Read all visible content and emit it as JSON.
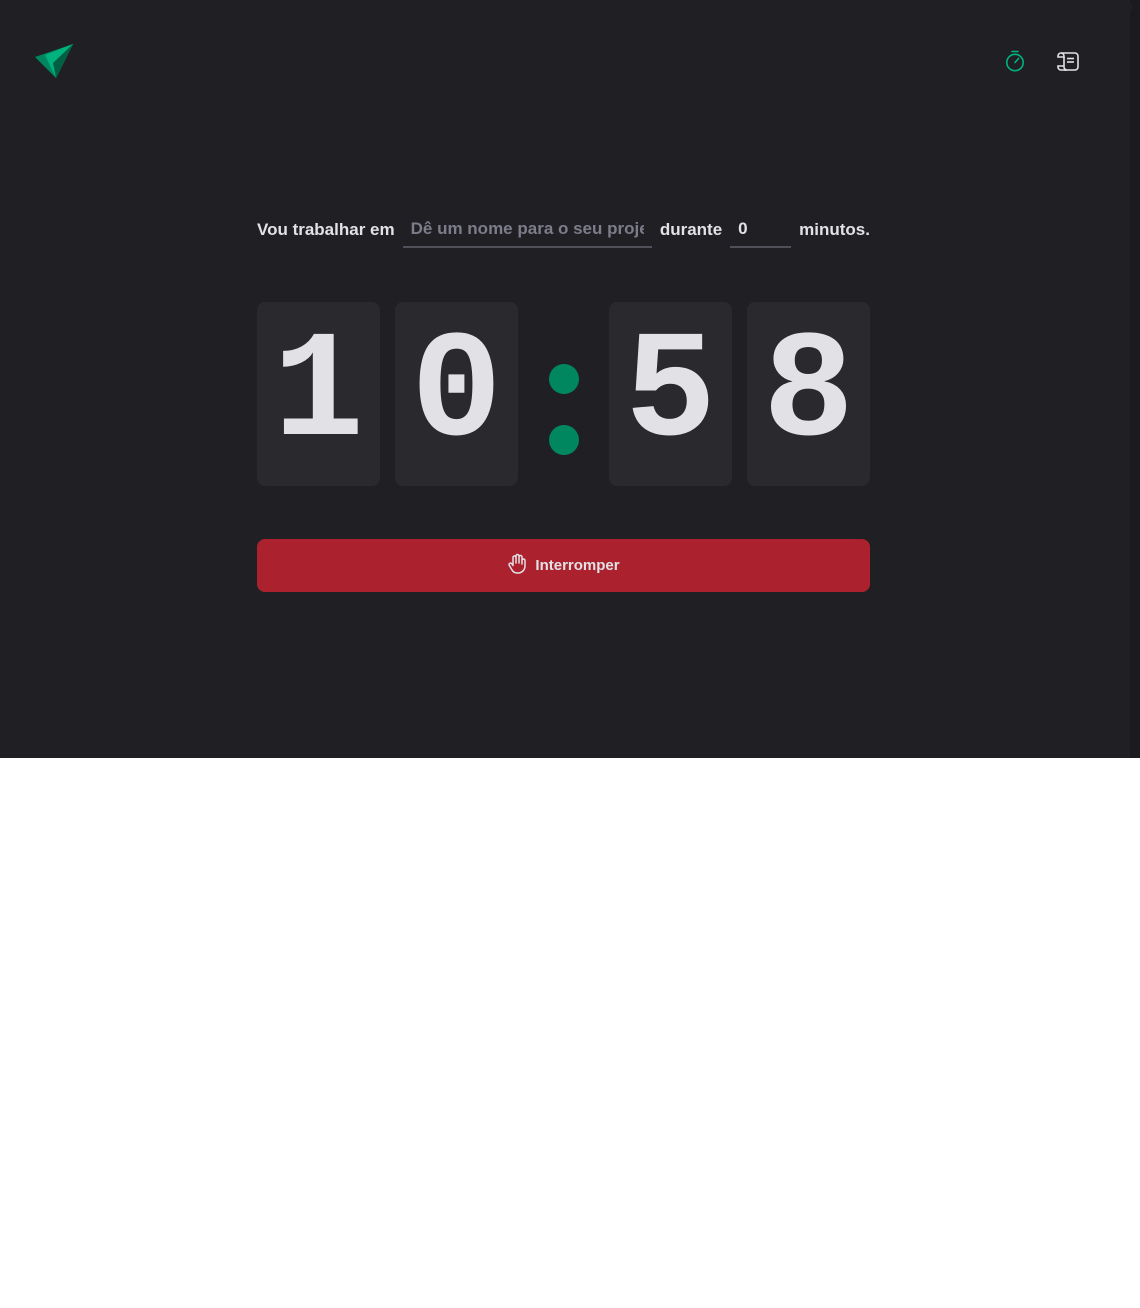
{
  "colors": {
    "background": "#202024",
    "accent": "#00875f",
    "accent_light": "#00b37e",
    "danger": "#ab222e",
    "text": "#e1e1e6",
    "digit_bg": "#29292e"
  },
  "header": {
    "logo_icon": "paper-plane-logo-icon",
    "nav": [
      {
        "icon": "timer-icon",
        "active": true
      },
      {
        "icon": "scroll-history-icon",
        "active": false
      }
    ]
  },
  "form": {
    "label_start": "Vou trabalhar em",
    "task_placeholder": "Dê um nome para o seu projeto",
    "task_value": "",
    "label_middle": "durante",
    "minutes_value": "0",
    "label_end": "minutos."
  },
  "countdown": {
    "minutes_tens": "1",
    "minutes_ones": "0",
    "seconds_tens": "5",
    "seconds_ones": "8"
  },
  "stop_button": {
    "label": "Interromper",
    "icon": "hand-palm-icon"
  }
}
